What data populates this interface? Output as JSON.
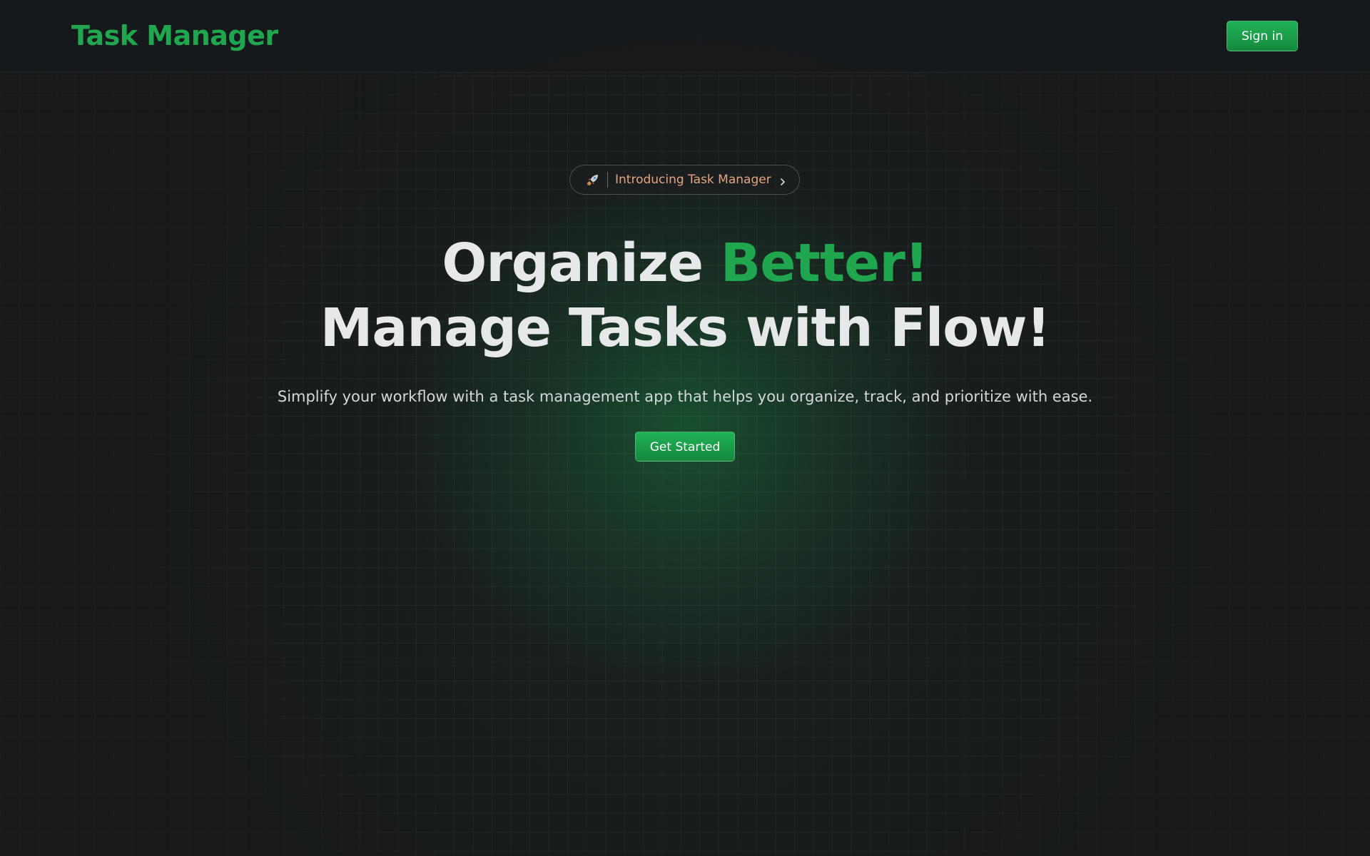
{
  "header": {
    "brand": "Task Manager",
    "signin_label": "Sign in"
  },
  "hero": {
    "badge": {
      "icon": "rocket-icon",
      "text": "Introducing Task Manager",
      "chevron_icon": "chevron-right-icon"
    },
    "title_line1_main": "Organize",
    "title_line1_accent": "Better!",
    "title_line2": "Manage Tasks with Flow!",
    "subtitle": "Simplify your workflow with a task management app that helps you organize, track, and prioritize with ease.",
    "cta_label": "Get Started"
  },
  "colors": {
    "background": "#17191b",
    "accent": "#1fa64e",
    "button_top": "#21b356",
    "button_bottom": "#15883d",
    "badge_text": "#e3a57f",
    "heading_text": "#e6e8ea"
  }
}
